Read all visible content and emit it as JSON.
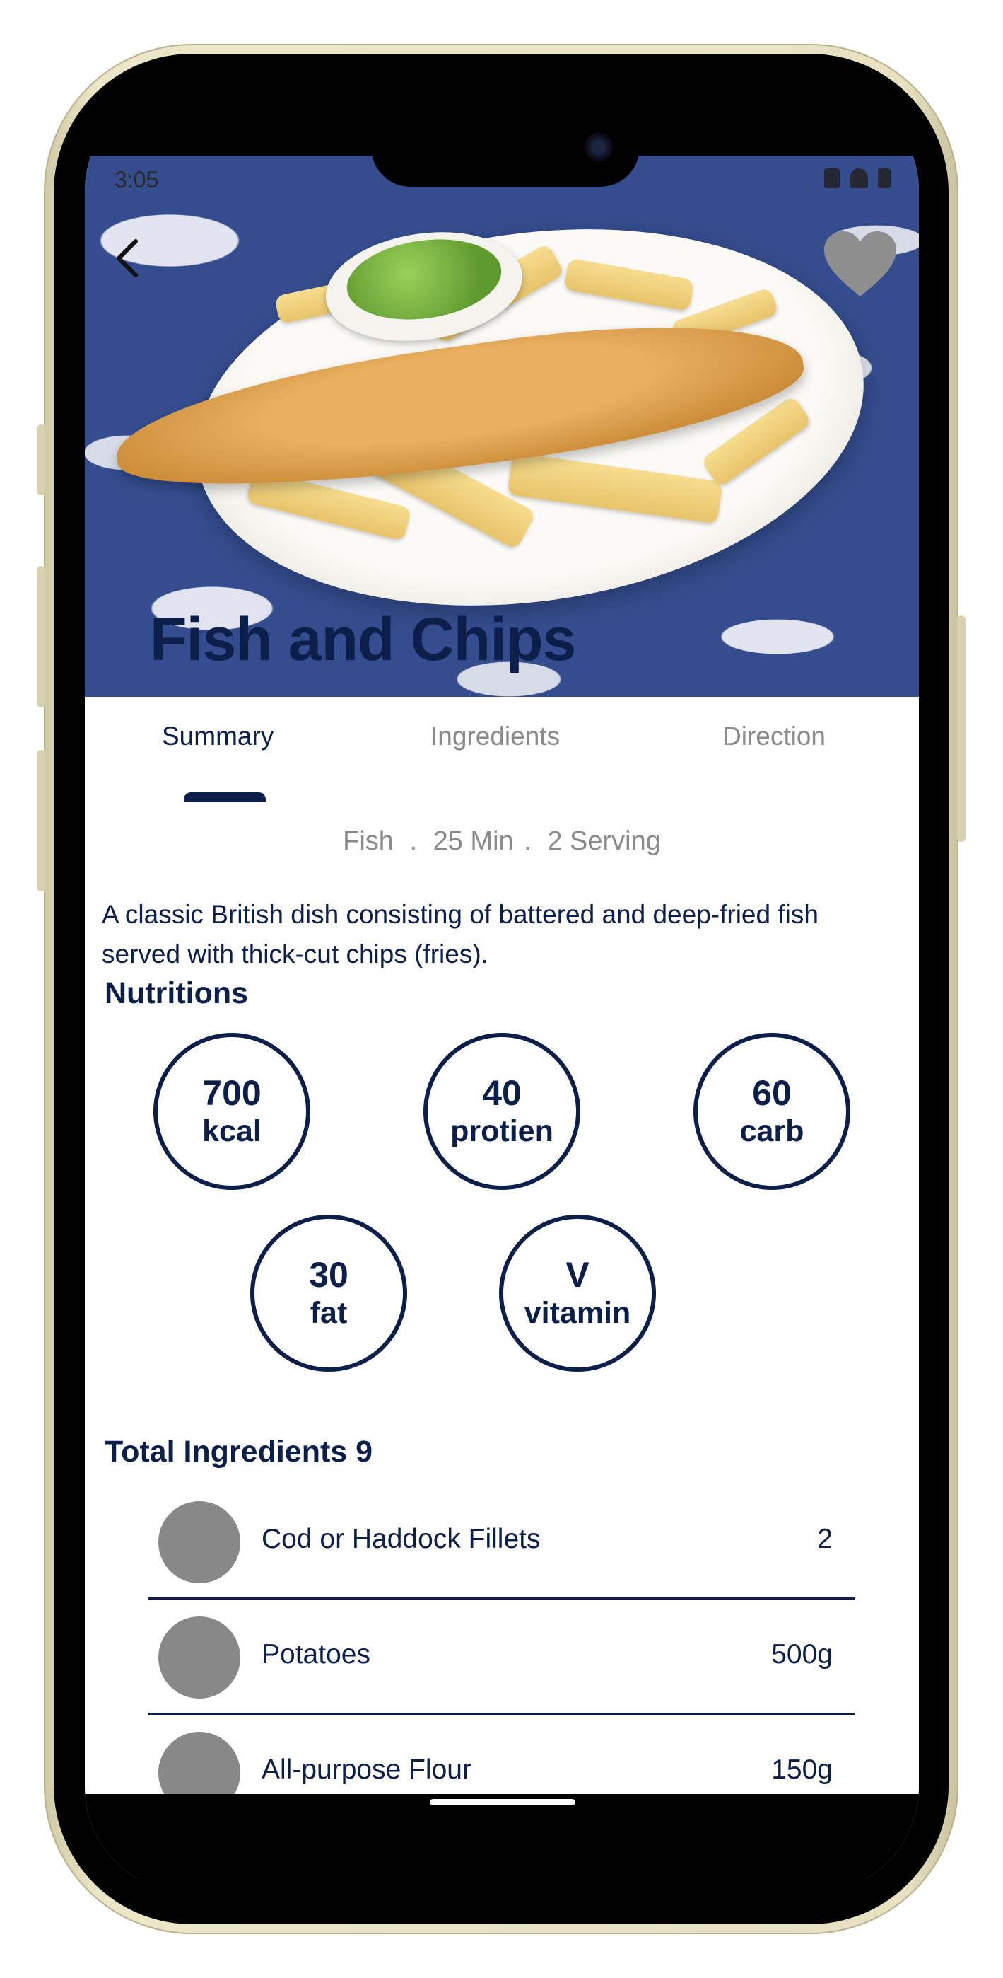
{
  "status_bar": {
    "time": "3:05"
  },
  "recipe": {
    "title": "Fish and Chips",
    "meta": {
      "category": "Fish",
      "sep1": ".",
      "time": "25 Min",
      "sep2": ".",
      "servings": "2 Serving"
    },
    "description": "A classic British dish consisting of battered and deep-fried fish served with thick-cut chips (fries)."
  },
  "tabs": [
    {
      "label": "Summary",
      "active": true
    },
    {
      "label": "Ingredients",
      "active": false
    },
    {
      "label": "Direction",
      "active": false
    }
  ],
  "nutrition": {
    "title": "Nutritions",
    "items": [
      {
        "value": "700",
        "unit": "kcal"
      },
      {
        "value": "40",
        "unit": "protien"
      },
      {
        "value": "60",
        "unit": "carb"
      },
      {
        "value": "30",
        "unit": "fat"
      },
      {
        "value": "V",
        "unit": "vitamin"
      }
    ]
  },
  "ingredients": {
    "title": "Total Ingredients 9",
    "items": [
      {
        "name": "Cod or Haddock Fillets",
        "qty": "2"
      },
      {
        "name": "Potatoes",
        "qty": "500g"
      },
      {
        "name": "All-purpose Flour",
        "qty": "150g"
      }
    ]
  },
  "colors": {
    "primary": "#0c1e4a",
    "muted": "#8a8a8a",
    "avatar": "#888888"
  },
  "icons": {
    "back": "chevron-left-icon",
    "favorite": "heart-icon"
  }
}
